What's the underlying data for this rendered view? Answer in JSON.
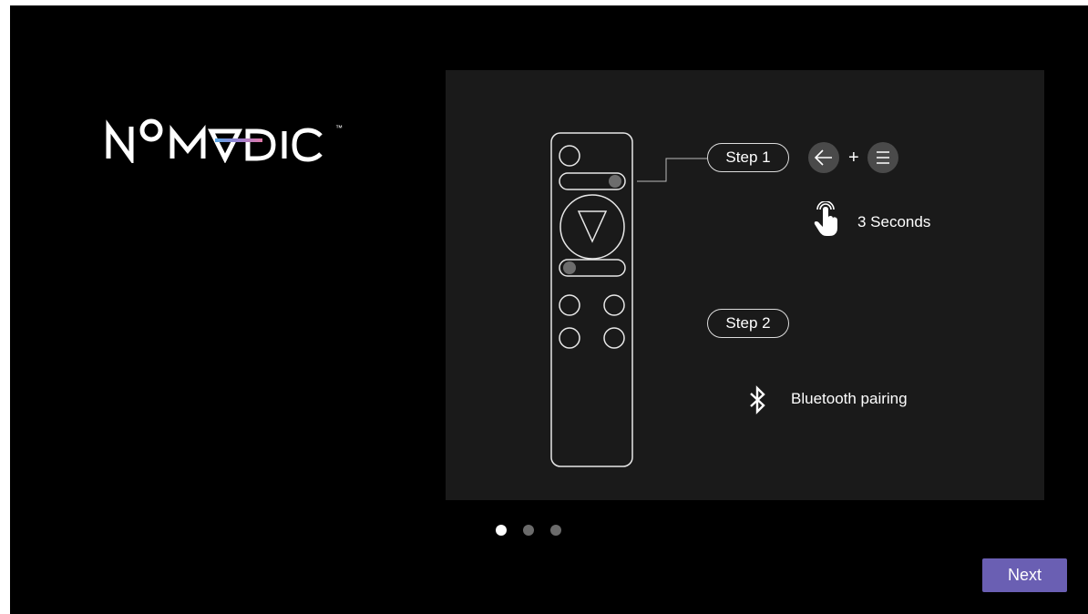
{
  "brand": {
    "logo_text": "NOMVDIC",
    "trademark": "™"
  },
  "illustration": {
    "step1_label": "Step 1",
    "plus": "+",
    "duration_label": "3  Seconds",
    "step2_label": "Step 2",
    "bluetooth_label": "Bluetooth pairing",
    "icons": {
      "back": "arrow-left-icon",
      "menu": "menu-lines-icon",
      "touch": "hand-press-icon",
      "bluetooth": "bluetooth-icon"
    }
  },
  "pagination": {
    "pages": 3,
    "current": 1,
    "active_color": "#ffffff",
    "inactive_color": "#6b6b6b"
  },
  "footer": {
    "next_label": "Next",
    "accent": "#6a5fb3"
  }
}
